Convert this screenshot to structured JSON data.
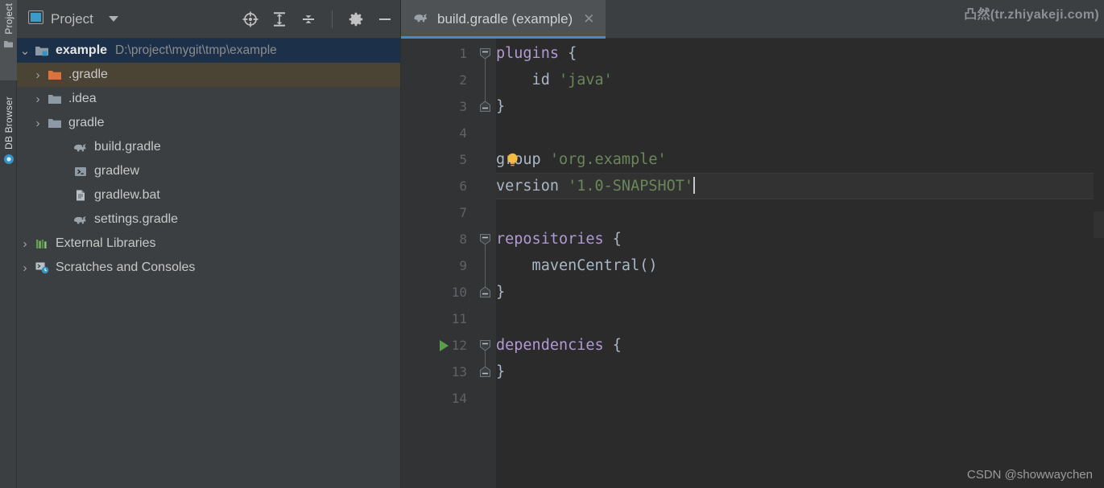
{
  "rail": {
    "tabs": [
      {
        "label": "Project",
        "icon": "folder-icon",
        "active": true
      },
      {
        "label": "DB Browser",
        "icon": "database-icon",
        "active": false
      }
    ]
  },
  "project_panel": {
    "toolbar": {
      "title": "Project",
      "title_icon": "project-window-icon",
      "dropdown_icon": "chevron-down-icon",
      "icons": [
        {
          "name": "locate-icon",
          "title": "Select Opened File"
        },
        {
          "name": "expand-all-icon",
          "title": "Expand All"
        },
        {
          "name": "collapse-all-icon",
          "title": "Collapse All"
        },
        {
          "name": "gear-icon",
          "title": "Options"
        },
        {
          "name": "minimize-icon",
          "title": "Hide"
        }
      ]
    },
    "tree": [
      {
        "label": "example",
        "path": "D:\\project\\mygit\\tmp\\example",
        "icon": "project-folder-icon",
        "chevron": "v",
        "indent": 0,
        "state": "selected",
        "bold": true
      },
      {
        "label": ".gradle",
        "path": "",
        "icon": "folder-orange-icon",
        "chevron": ">",
        "indent": 1,
        "state": "hovered",
        "bold": false
      },
      {
        "label": ".idea",
        "path": "",
        "icon": "folder-icon",
        "chevron": ">",
        "indent": 1,
        "state": "",
        "bold": false
      },
      {
        "label": "gradle",
        "path": "",
        "icon": "folder-icon",
        "chevron": ">",
        "indent": 1,
        "state": "",
        "bold": false
      },
      {
        "label": "build.gradle",
        "path": "",
        "icon": "gradle-elephant-icon",
        "chevron": "",
        "indent": 2,
        "state": "",
        "bold": false
      },
      {
        "label": "gradlew",
        "path": "",
        "icon": "script-icon",
        "chevron": "",
        "indent": 2,
        "state": "",
        "bold": false
      },
      {
        "label": "gradlew.bat",
        "path": "",
        "icon": "batch-file-icon",
        "chevron": "",
        "indent": 2,
        "state": "",
        "bold": false
      },
      {
        "label": "settings.gradle",
        "path": "",
        "icon": "gradle-elephant-icon",
        "chevron": "",
        "indent": 2,
        "state": "",
        "bold": false
      },
      {
        "label": "External Libraries",
        "path": "",
        "icon": "libraries-icon",
        "chevron": ">",
        "indent": 0,
        "state": "",
        "bold": false
      },
      {
        "label": "Scratches and Consoles",
        "path": "",
        "icon": "scratches-icon",
        "chevron": ">",
        "indent": 0,
        "state": "",
        "bold": false
      }
    ]
  },
  "editor": {
    "tab": {
      "label": "build.gradle (example)",
      "icon": "gradle-elephant-icon",
      "close_icon": "close-icon",
      "active": true
    },
    "gutter": {
      "line_numbers": [
        "1",
        "2",
        "3",
        "4",
        "5",
        "6",
        "7",
        "8",
        "9",
        "10",
        "11",
        "12",
        "13",
        "14"
      ],
      "run_marker_line": 12,
      "fold_open_lines": [
        1,
        8,
        12
      ],
      "fold_close_lines": [
        3,
        10,
        13
      ]
    },
    "current_line": 6,
    "caret_line": 6,
    "intention_bulb_line": 5,
    "lines": [
      {
        "n": 1,
        "tokens": [
          {
            "t": "plugins",
            "c": "blockfn"
          },
          {
            "t": " {",
            "c": "brace"
          }
        ]
      },
      {
        "n": 2,
        "tokens": [
          {
            "t": "    id ",
            "c": "plain"
          },
          {
            "t": "'java'",
            "c": "str"
          }
        ]
      },
      {
        "n": 3,
        "tokens": [
          {
            "t": "}",
            "c": "brace"
          }
        ]
      },
      {
        "n": 4,
        "tokens": []
      },
      {
        "n": 5,
        "tokens": [
          {
            "t": "group ",
            "c": "plain"
          },
          {
            "t": "'org.example'",
            "c": "str"
          }
        ]
      },
      {
        "n": 6,
        "tokens": [
          {
            "t": "version ",
            "c": "plain"
          },
          {
            "t": "'1.0-SNAPSHOT'",
            "c": "str"
          }
        ]
      },
      {
        "n": 7,
        "tokens": []
      },
      {
        "n": 8,
        "tokens": [
          {
            "t": "repositories",
            "c": "blockfn"
          },
          {
            "t": " {",
            "c": "brace"
          }
        ]
      },
      {
        "n": 9,
        "tokens": [
          {
            "t": "    mavenCentral()",
            "c": "plain"
          }
        ]
      },
      {
        "n": 10,
        "tokens": [
          {
            "t": "}",
            "c": "brace"
          }
        ]
      },
      {
        "n": 11,
        "tokens": []
      },
      {
        "n": 12,
        "tokens": [
          {
            "t": "dependencies",
            "c": "blockfn"
          },
          {
            "t": " {",
            "c": "brace"
          }
        ]
      },
      {
        "n": 13,
        "tokens": [
          {
            "t": "}",
            "c": "brace"
          }
        ]
      },
      {
        "n": 14,
        "tokens": []
      }
    ]
  },
  "watermarks": {
    "top_right": "凸然(tr.zhiyakeji.com)",
    "bottom_right": "CSDN @showwaychen"
  },
  "colors": {
    "panel_bg": "#3c3f41",
    "editor_bg": "#2b2b2b",
    "gutter_bg": "#313335",
    "tab_active_underline": "#4a88c7",
    "selection_blue": "#1c3149",
    "hover_olive": "#4b4334",
    "string_green": "#6a8759",
    "block_purple": "#b09ad3",
    "run_green": "#5a9e4b",
    "bulb_yellow": "#f5bc42",
    "folder_orange": "#d9743c"
  }
}
